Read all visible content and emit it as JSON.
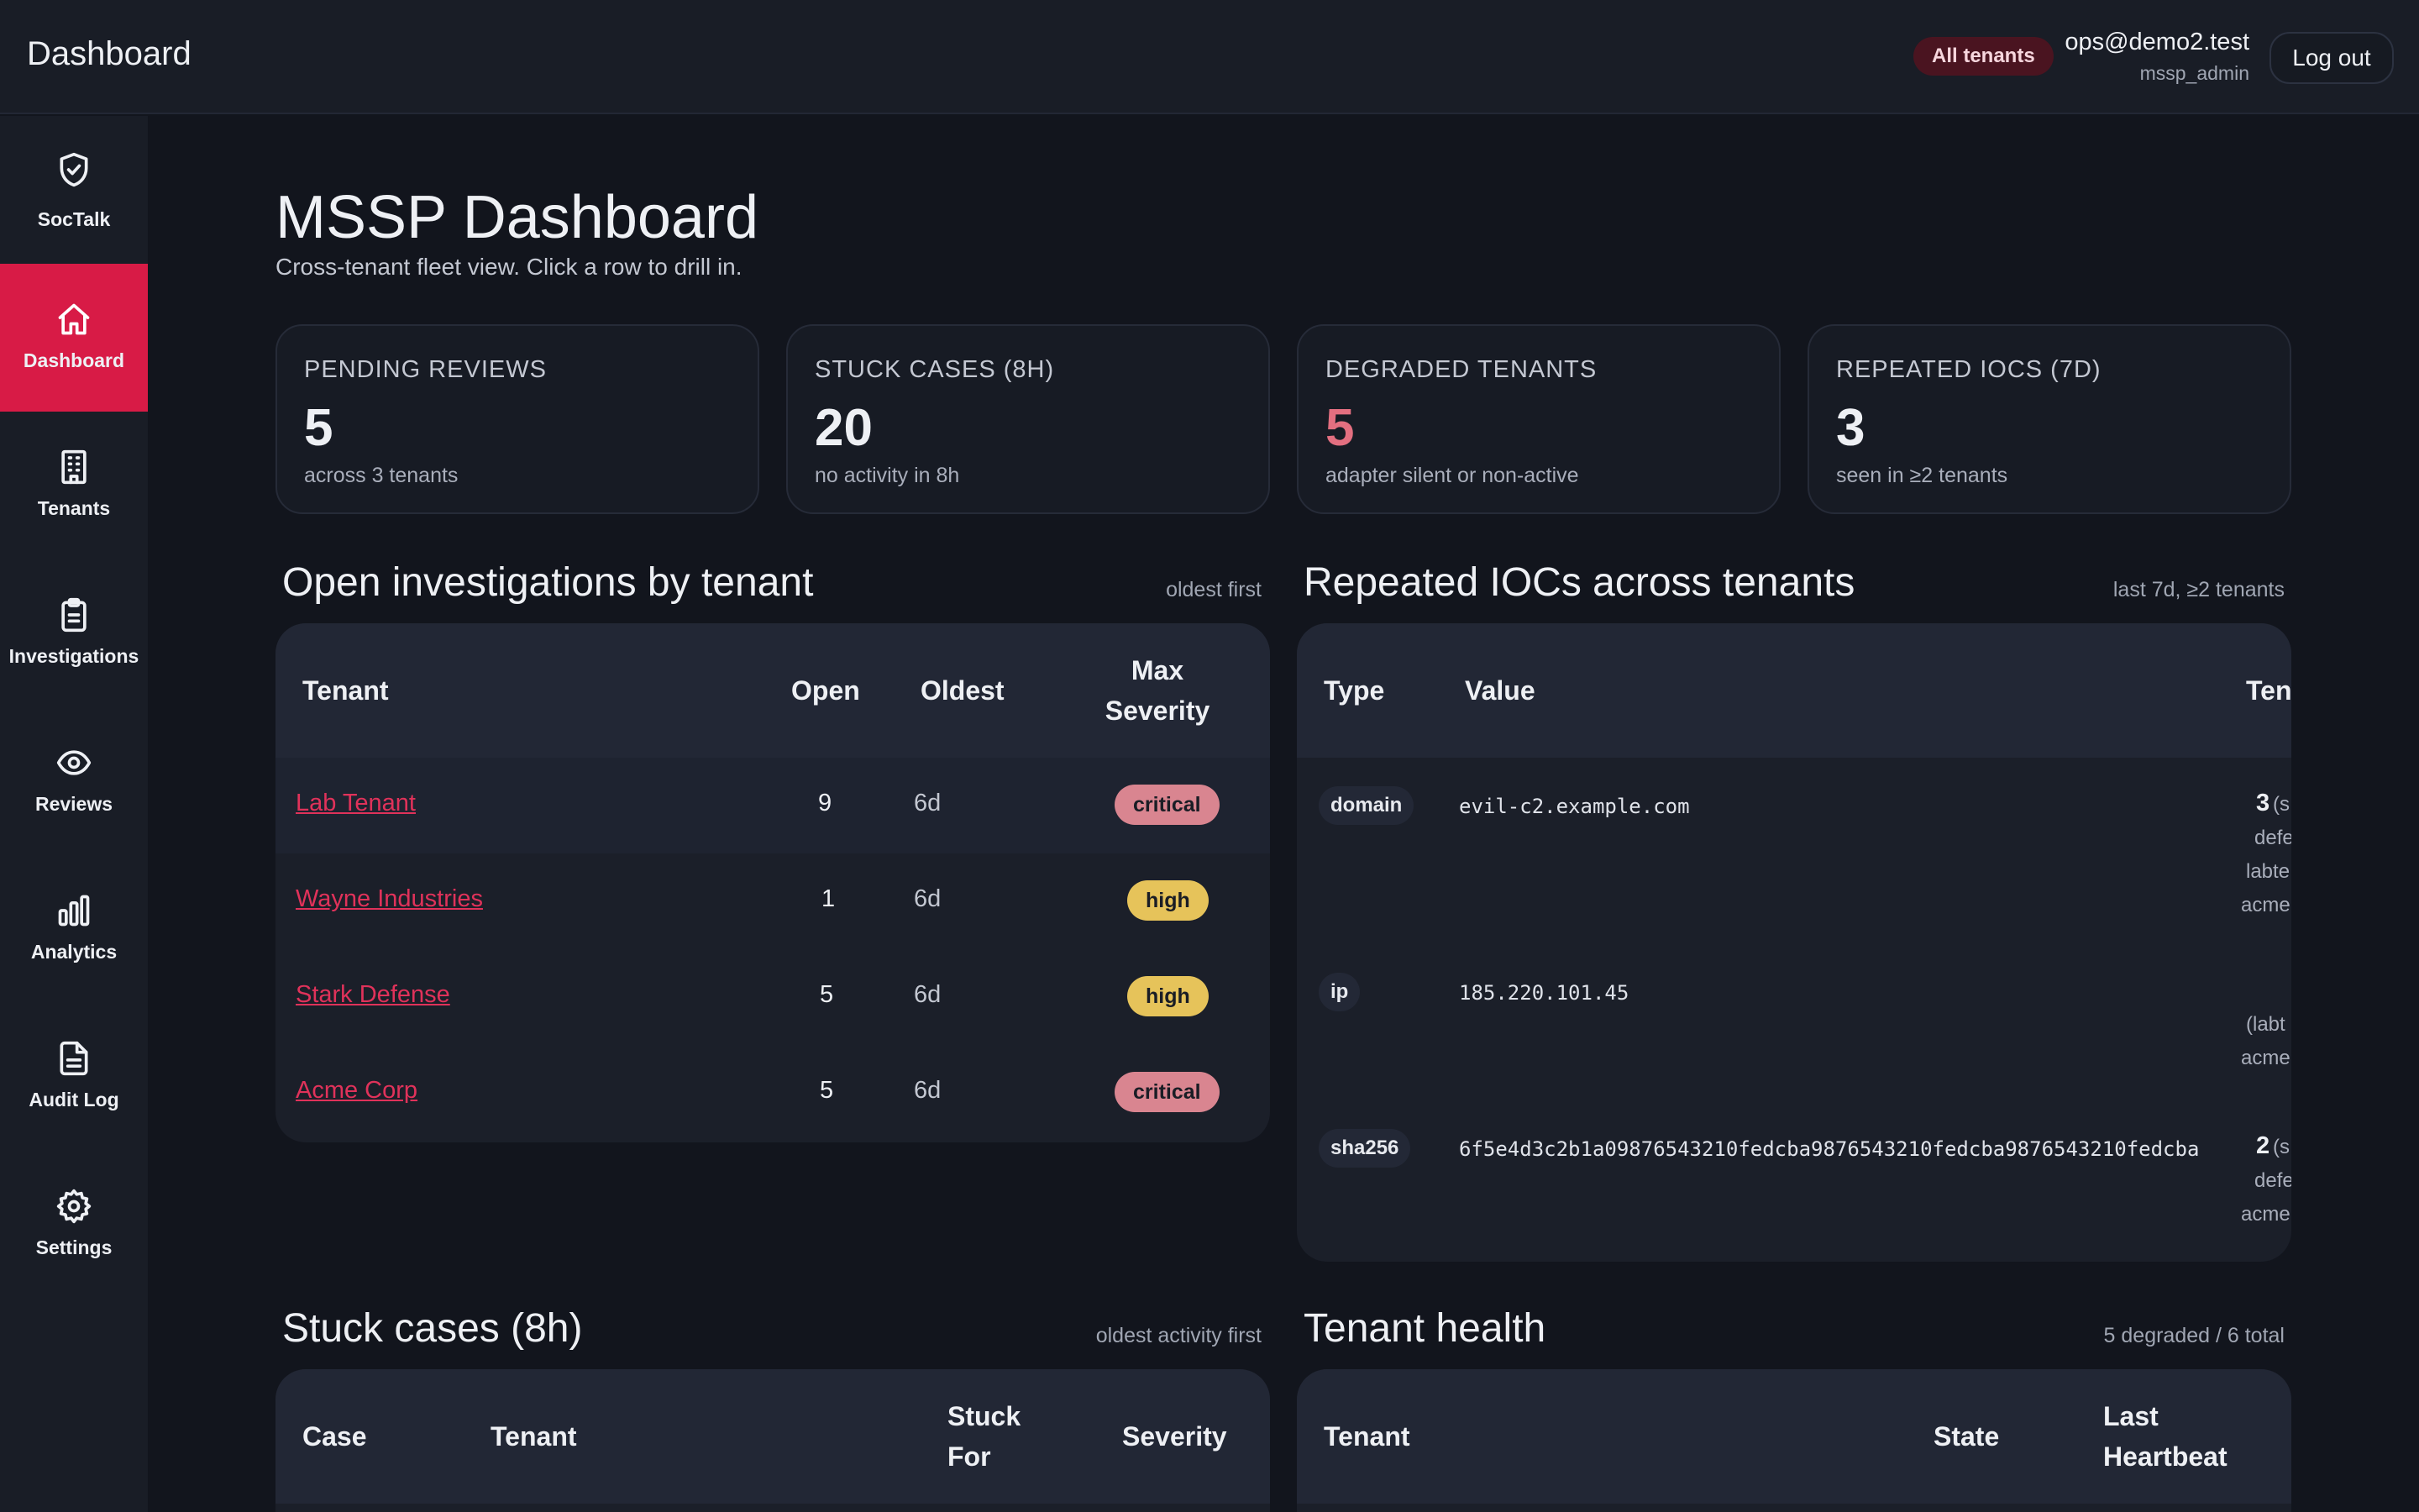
{
  "topbar": {
    "title": "Dashboard",
    "tenant_scope": "All tenants",
    "user_email": "ops@demo2.test",
    "user_role": "mssp_admin",
    "logout_label": "Log out"
  },
  "sidebar": {
    "brand": {
      "label": "SocTalk",
      "icon": "shield-check-icon"
    },
    "items": [
      {
        "label": "Dashboard",
        "icon": "home-icon",
        "active": true
      },
      {
        "label": "Tenants",
        "icon": "building-icon"
      },
      {
        "label": "Investigations",
        "icon": "clipboard-icon"
      },
      {
        "label": "Reviews",
        "icon": "eye-icon"
      },
      {
        "label": "Analytics",
        "icon": "bar-chart-icon"
      },
      {
        "label": "Audit Log",
        "icon": "document-icon"
      },
      {
        "label": "Settings",
        "icon": "gear-icon"
      }
    ]
  },
  "page": {
    "title": "MSSP Dashboard",
    "subtitle": "Cross-tenant fleet view. Click a row to drill in."
  },
  "kpis": [
    {
      "label": "PENDING REVIEWS",
      "value": "5",
      "note": "across 3 tenants"
    },
    {
      "label": "STUCK CASES (8H)",
      "value": "20",
      "note": "no activity in 8h"
    },
    {
      "label": "DEGRADED TENANTS",
      "value": "5",
      "note": "adapter silent or non-active",
      "color": "#e36f80"
    },
    {
      "label": "REPEATED IOCS (7D)",
      "value": "3",
      "note": "seen in ≥2 tenants"
    }
  ],
  "open_investigations": {
    "title": "Open investigations by tenant",
    "note": "oldest first",
    "columns": {
      "tenant": "Tenant",
      "open": "Open",
      "oldest": "Oldest",
      "max_severity_1": "Max",
      "max_severity_2": "Severity"
    },
    "rows": [
      {
        "tenant": "Lab Tenant",
        "open": "9",
        "oldest": "6d",
        "severity": "critical"
      },
      {
        "tenant": "Wayne Industries",
        "open": "1",
        "oldest": "6d",
        "severity": "high"
      },
      {
        "tenant": "Stark Defense",
        "open": "5",
        "oldest": "6d",
        "severity": "high"
      },
      {
        "tenant": "Acme Corp",
        "open": "5",
        "oldest": "6d",
        "severity": "critical"
      }
    ]
  },
  "repeated_iocs": {
    "title": "Repeated IOCs across tenants",
    "note": "last 7d, ≥2 tenants",
    "columns": {
      "type": "Type",
      "value": "Value",
      "tenants": "Ten"
    },
    "rows": [
      {
        "type": "domain",
        "value": "evil-c2.example.com",
        "count": "3",
        "count_suffix": "(s",
        "tenants": [
          "defe",
          "labte",
          "acme"
        ]
      },
      {
        "type": "ip",
        "value": "185.220.101.45",
        "count": "",
        "count_suffix": "",
        "tenants": [
          "(labt",
          "acme"
        ]
      },
      {
        "type": "sha256",
        "value": "6f5e4d3c2b1a09876543210fedcba9876543210fedcba9876543210fedcba",
        "count": "2",
        "count_suffix": "(s",
        "tenants": [
          "defe",
          "acme"
        ]
      }
    ]
  },
  "stuck_cases": {
    "title": "Stuck cases (8h)",
    "note": "oldest activity first",
    "columns": {
      "case": "Case",
      "tenant": "Tenant",
      "stuck_for_1": "Stuck",
      "stuck_for_2": "For",
      "severity": "Severity"
    }
  },
  "tenant_health": {
    "title": "Tenant health",
    "note": "5 degraded / 6 total",
    "columns": {
      "tenant": "Tenant",
      "state": "State",
      "last_heartbeat_1": "Last",
      "last_heartbeat_2": "Heartbeat"
    }
  }
}
